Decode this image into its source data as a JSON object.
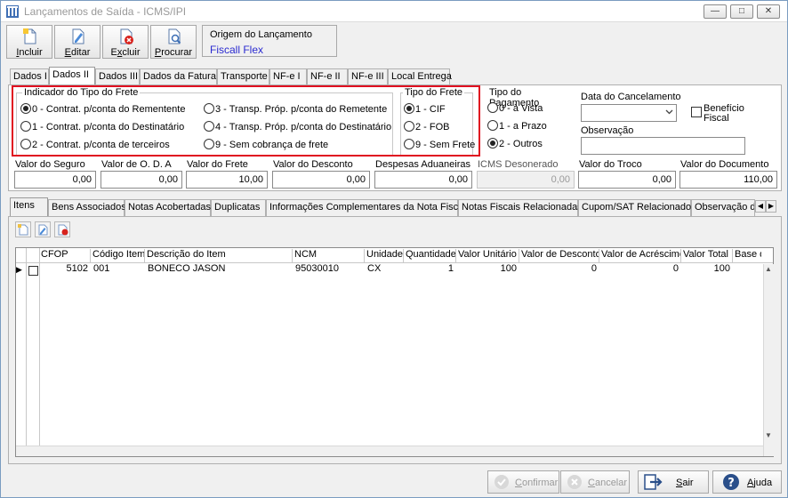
{
  "window": {
    "title": "Lançamentos de Saída - ICMS/IPI",
    "minimize": "—",
    "maximize": "□",
    "close": "✕"
  },
  "toolbar": {
    "incluir": "Incluir",
    "editar": "Editar",
    "excluir": "Excluir",
    "procurar": "Procurar"
  },
  "origin": {
    "title": "Origem do Lançamento",
    "value": "Fiscall Flex"
  },
  "main_tabs": [
    "Dados I",
    "Dados II",
    "Dados III",
    "Dados da Fatura",
    "Transporte",
    "NF-e I",
    "NF-e II",
    "NF-e III",
    "Local Entrega"
  ],
  "frete": {
    "title": "Indicador do Tipo do Frete",
    "options": [
      "0 - Contrat. p/conta do Rementente",
      "1 - Contrat. p/conta do Destinatário",
      "2 - Contrat. p/conta de terceiros",
      "3 - Transp. Próp. p/conta do Remetente",
      "4 - Transp. Próp. p/conta do Destinatário",
      "9 - Sem cobrança de frete"
    ],
    "selected": 0
  },
  "tipo_frete": {
    "title": "Tipo do Frete",
    "options": [
      "1 - CIF",
      "2 - FOB",
      "9 - Sem Frete"
    ],
    "selected": 0
  },
  "pagamento": {
    "title": "Tipo do Pagamento",
    "options": [
      "0 - à Vista",
      "1 - a Prazo",
      "2 - Outros"
    ],
    "selected": 2
  },
  "cancelamento": {
    "label": "Data do Cancelamento",
    "value": ""
  },
  "beneficio": {
    "label_line1": "Benefício",
    "label_line2": "Fiscal",
    "checked": false
  },
  "observacao": {
    "label": "Observação",
    "value": ""
  },
  "valores": {
    "seguro_label": "Valor do Seguro",
    "seguro": "0,00",
    "oda_label": "Valor de O. D. A",
    "oda": "0,00",
    "frete_label": "Valor do Frete",
    "frete": "10,00",
    "desconto_label": "Valor do Desconto",
    "desconto": "0,00",
    "aduaneiras_label": "Despesas Aduaneiras",
    "aduaneiras": "0,00",
    "icms_label": "ICMS Desonerado",
    "icms": "0,00",
    "troco_label": "Valor do Troco",
    "troco": "0,00",
    "documento_label": "Valor do Documento",
    "documento": "110,00"
  },
  "sub_tabs": [
    "Itens",
    "Bens Associados",
    "Notas Acobertadas",
    "Duplicatas",
    "Informações Complementares da Nota Fiscal",
    "Notas Fiscais Relacionadas",
    "Cupom/SAT Relacionados",
    "Observação d"
  ],
  "grid": {
    "columns": [
      "CFOP",
      "Código Item",
      "Descrição do Item",
      "NCM",
      "Unidade",
      "Quantidade",
      "Valor Unitário",
      "Valor de Desconto",
      "Valor de Acréscimo",
      "Valor Total",
      "Base d"
    ],
    "rows": [
      [
        "5102",
        "001",
        "BONECO JASON",
        "95030010",
        "CX",
        "1",
        "100",
        "0",
        "0",
        "100",
        ""
      ]
    ]
  },
  "buttons": {
    "confirmar": "Confirmar",
    "cancelar": "Cancelar",
    "sair": "Sair",
    "ajuda": "Ajuda"
  }
}
